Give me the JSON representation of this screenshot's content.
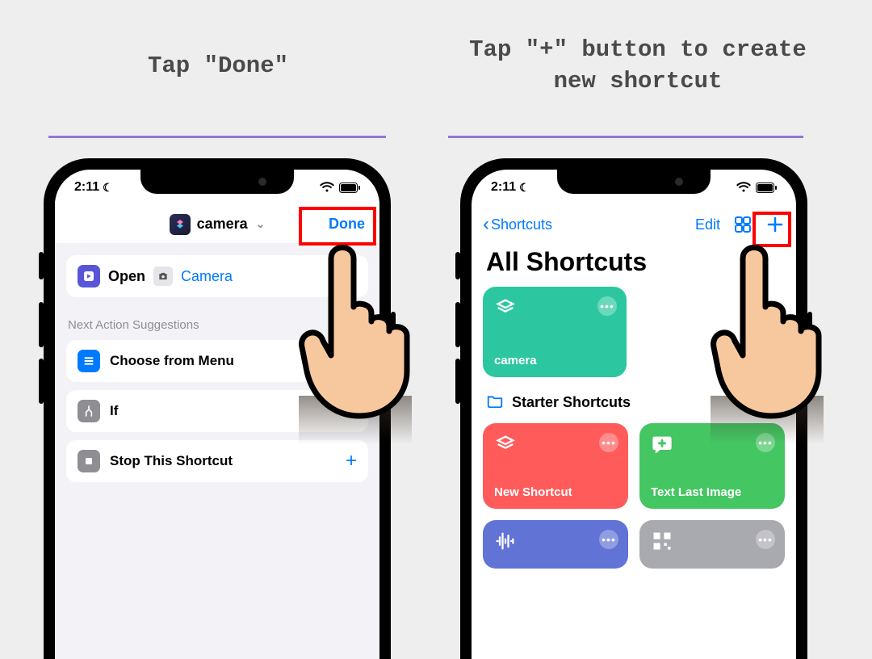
{
  "captions": {
    "left": "Tap \"Done\"",
    "right": "Tap \"+\" button to create new shortcut"
  },
  "status": {
    "time": "2:11"
  },
  "screen1": {
    "title": "camera",
    "done_label": "Done",
    "action": {
      "verb": "Open",
      "param": "Camera"
    },
    "suggestions_header": "Next Action Suggestions",
    "suggestions": [
      {
        "label": "Choose from Menu"
      },
      {
        "label": "If"
      },
      {
        "label": "Stop This Shortcut"
      }
    ]
  },
  "screen2": {
    "back_label": "Shortcuts",
    "edit_label": "Edit",
    "title": "All Shortcuts",
    "tiles": {
      "camera": "camera",
      "folder_label": "Starter Shortcuts",
      "new_shortcut": "New Shortcut",
      "text_last_image": "Text Last Image"
    }
  }
}
